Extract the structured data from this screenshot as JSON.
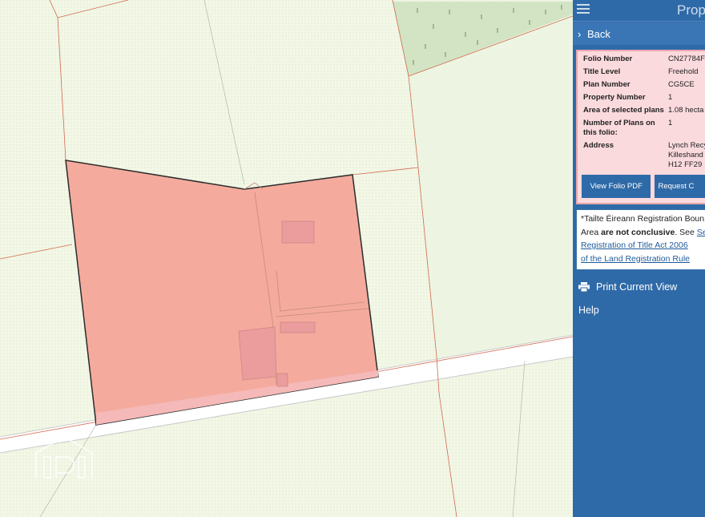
{
  "panel": {
    "title": "Prop",
    "back_label": "Back",
    "folio": {
      "rows": [
        {
          "label": "Folio Number",
          "value": "CN27784F"
        },
        {
          "label": "Title Level",
          "value": "Freehold"
        },
        {
          "label": "Plan Number",
          "value": "CG5CE"
        },
        {
          "label": "Property Number",
          "value": "1"
        },
        {
          "label": "Area of selected plans",
          "value": "1.08 hecta"
        },
        {
          "label": "Number of Plans on this folio:",
          "value": "1"
        },
        {
          "label": "Address",
          "value_lines": [
            "Lynch Recy",
            "Killeshand",
            "H12 FF29"
          ]
        }
      ],
      "view_pdf_label": "View Folio PDF",
      "request_label": "Request C"
    },
    "notice": {
      "line1": "*Tailte Éireann Registration Boun",
      "line2_pre": "Area ",
      "line2_bold": "are not conclusive",
      "line2_post": ". See ",
      "line2_link": "Se",
      "link_line3": "Registration of Title Act 2006",
      "link_line4": "of the Land Registration Rule"
    },
    "print_label": "Print Current View",
    "help_label": "Help"
  },
  "map": {
    "watermark": "IPI",
    "colors": {
      "parcel_fill": "#f5a79a",
      "field": "#f2f7e6",
      "road": "#ffffff",
      "boundary": "#d26a4e",
      "forest": "#cfe4c2"
    }
  }
}
